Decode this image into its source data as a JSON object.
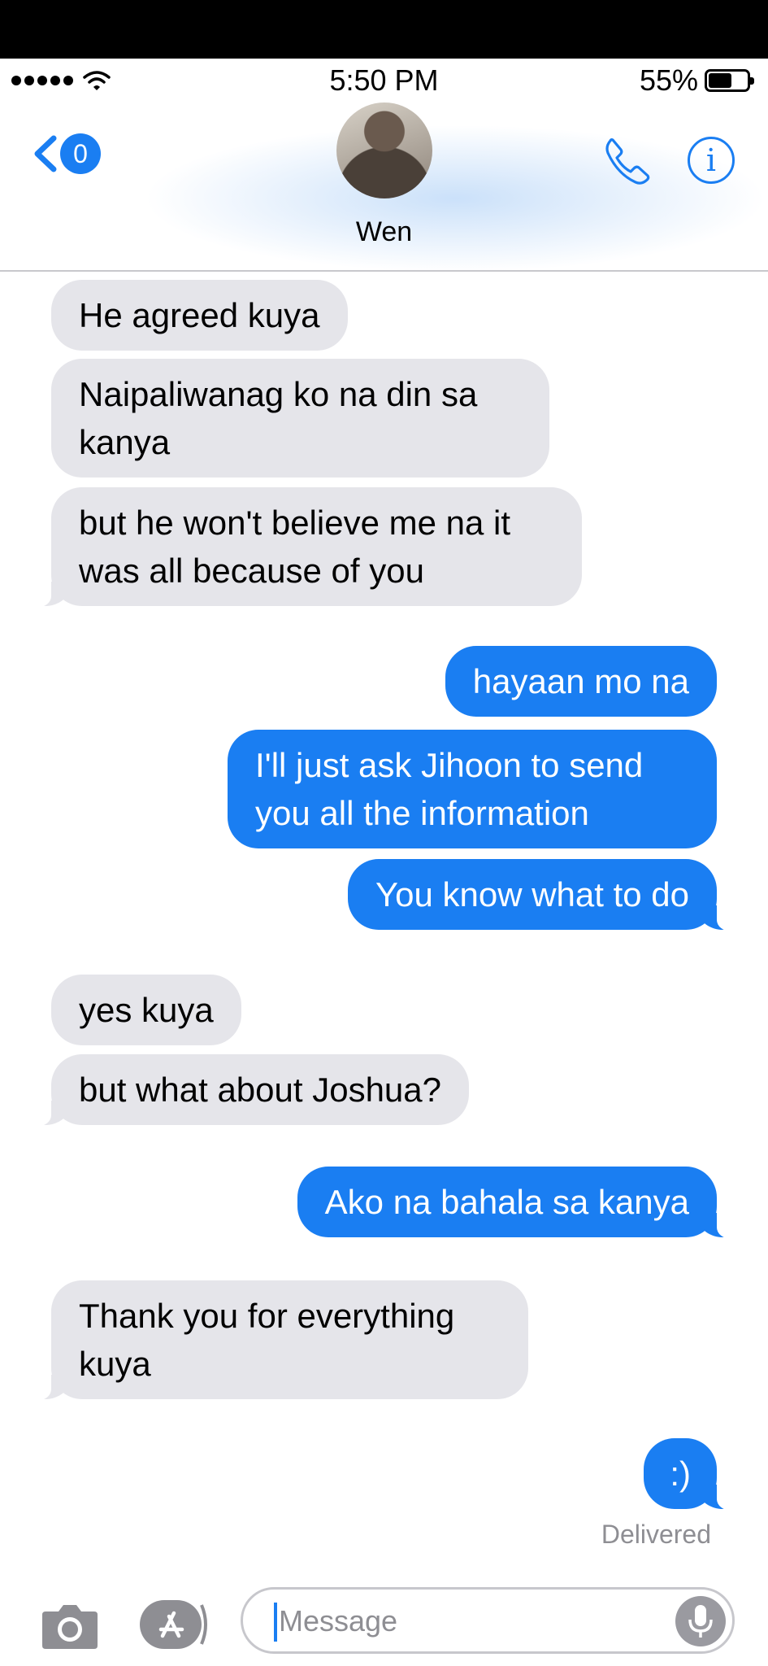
{
  "status_bar": {
    "time": "5:50 PM",
    "battery": "55%",
    "battery_level": 0.55,
    "signal_dots": 5,
    "icons": [
      "signal-dots-icon",
      "wifi-icon",
      "battery-icon"
    ]
  },
  "header": {
    "unread_count": "0",
    "contact_name": "Wen",
    "icons": [
      "chevron-left-icon",
      "avatar",
      "phone-icon",
      "info-icon"
    ]
  },
  "messages": [
    {
      "from": "contact",
      "text": "He agreed kuya"
    },
    {
      "from": "contact",
      "text": "Naipaliwanag ko na din sa kanya"
    },
    {
      "from": "contact",
      "text": "but he won't believe me na it was all because of you"
    },
    {
      "from": "me",
      "text": "hayaan mo na"
    },
    {
      "from": "me",
      "text": "I'll just ask Jihoon to send you all the information"
    },
    {
      "from": "me",
      "text": "You know what to do"
    },
    {
      "from": "contact",
      "text": "yes kuya"
    },
    {
      "from": "contact",
      "text": "but what about Joshua?"
    },
    {
      "from": "me",
      "text": "Ako na bahala sa kanya"
    },
    {
      "from": "contact",
      "text": "Thank you for everything kuya"
    },
    {
      "from": "me",
      "text": ":)"
    }
  ],
  "delivery_status": "Delivered",
  "input_bar": {
    "placeholder": "Message",
    "icons": [
      "camera-icon",
      "app-store-icon",
      "microphone-icon"
    ]
  },
  "colors": {
    "accent": "#1a7ef2",
    "incoming_bubble": "#e5e5ea",
    "outgoing_bubble": "#1a7ef2",
    "muted_text": "#8e8e93"
  }
}
